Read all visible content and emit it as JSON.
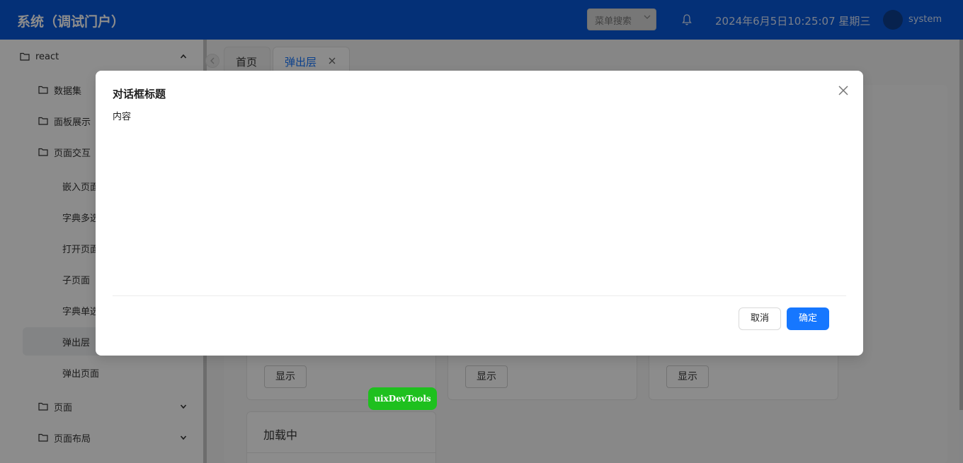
{
  "header": {
    "app_title": "系统（调试门户）",
    "menu_search_placeholder": "菜单搜索",
    "datetime": "2024年6月5日10:25:07 星期三",
    "username": "system",
    "bg_color": "#0958d9"
  },
  "sidebar": {
    "items": [
      {
        "label": "react"
      },
      {
        "label": "数据集"
      },
      {
        "label": "面板展示"
      },
      {
        "label": "页面交互"
      },
      {
        "label": "嵌入页面"
      },
      {
        "label": "字典多选"
      },
      {
        "label": "打开页面"
      },
      {
        "label": "子页面"
      },
      {
        "label": "字典单选"
      },
      {
        "label": "弹出层"
      },
      {
        "label": "弹出页面"
      },
      {
        "label": "页面"
      },
      {
        "label": "页面布局"
      }
    ]
  },
  "tabs": [
    {
      "label": "首页"
    },
    {
      "label": "弹出层"
    }
  ],
  "content": {
    "show_label": "显示",
    "loading_title": "加载中",
    "devtools_label": "uixDevTools"
  },
  "modal": {
    "title": "对话框标题",
    "body": "内容",
    "cancel_label": "取消",
    "ok_label": "确定",
    "primary_color": "#1677ff"
  }
}
